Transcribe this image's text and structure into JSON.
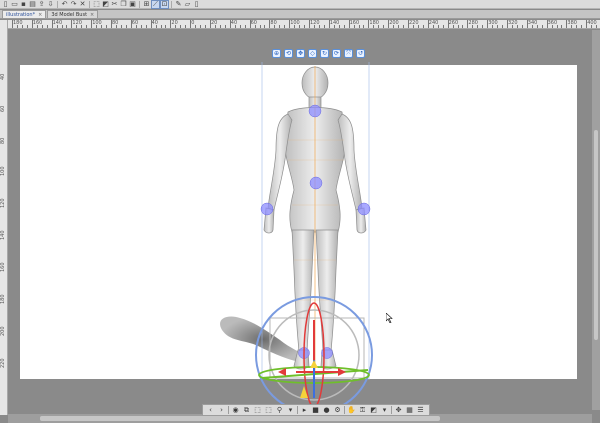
{
  "toolbar": {
    "icons": [
      "new-file-icon",
      "open-file-icon",
      "save-icon",
      "print-icon",
      "export-icon",
      "import-icon",
      "undo-icon",
      "redo-icon",
      "clear-icon",
      "transform-icon",
      "fill-icon",
      "cut-icon",
      "copy-icon",
      "paste-icon",
      "ruler-icon",
      "snap-ruler-icon",
      "snap-grid-icon",
      "pen-icon",
      "eraser-icon",
      "phone-icon"
    ]
  },
  "tabs": [
    {
      "label": "illustration*",
      "active": true
    },
    {
      "label": "3d Model Bust",
      "active": false
    }
  ],
  "ruler": {
    "top_labels": [
      "180",
      "160",
      "140",
      "120",
      "100",
      "80",
      "60",
      "40",
      "20",
      "0",
      "20",
      "40",
      "60",
      "80",
      "100",
      "120",
      "140",
      "160",
      "180",
      "200",
      "220",
      "240",
      "260",
      "280",
      "300",
      "320",
      "340",
      "360",
      "380",
      "400"
    ],
    "left_labels": [
      "40",
      "60",
      "80",
      "100",
      "120",
      "140",
      "160",
      "180",
      "200",
      "220"
    ]
  },
  "model_toolbar": {
    "icons": [
      "move-camera-icon",
      "rotate-camera-icon",
      "pan-camera-icon",
      "move-plane-icon",
      "rotate-object-icon",
      "rotate-plane-icon",
      "scale-icon",
      "reset-icon"
    ]
  },
  "bottom_bar": {
    "icons": [
      "prev-icon",
      "next-icon",
      "camera-icon",
      "camera-angle-icon",
      "frame-icon",
      "transform-icon",
      "pose-icon",
      "dropdown-icon",
      "play-icon",
      "stop-icon",
      "record-icon",
      "settings-icon",
      "hand-icon",
      "lock-icon",
      "fill-icon",
      "dropdown-icon",
      "move-icon",
      "grid-icon",
      "layers-icon"
    ]
  },
  "colors": {
    "canvas": "#ffffff",
    "workspace": "#8a8a8a",
    "joint": "#8c8cff",
    "axis_x": "#e23a3a",
    "axis_y": "#6fbf2a",
    "axis_z": "#3b6fe0",
    "accent": "#5b8fd8"
  }
}
